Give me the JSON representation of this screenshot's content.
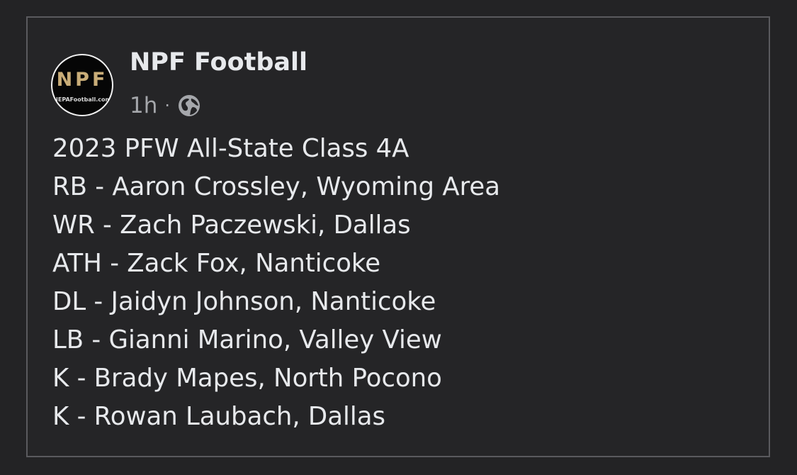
{
  "post": {
    "avatar": {
      "logo_text": "NPF",
      "site_text": "NEPAFootball.com"
    },
    "page_name": "NPF Football",
    "timestamp": "1h",
    "separator": "·",
    "audience_icon": "globe-icon",
    "lines": [
      "2023 PFW All-State Class 4A",
      "RB - Aaron Crossley, Wyoming Area",
      "WR - Zach Paczewski, Dallas",
      "ATH - Zack Fox, Nanticoke",
      "DL - Jaidyn Johnson, Nanticoke",
      "LB - Gianni Marino, Valley View",
      "K - Brady Mapes, North Pocono",
      "K - Rowan Laubach, Dallas"
    ]
  }
}
